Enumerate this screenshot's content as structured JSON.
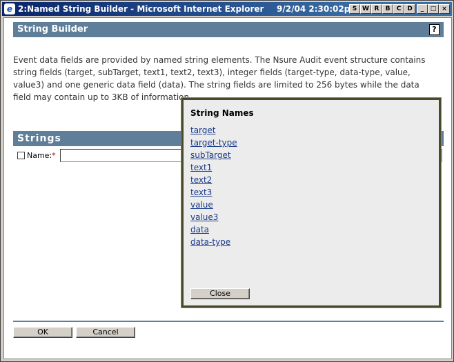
{
  "window": {
    "title": "2:Named String Builder - Microsoft Internet Explorer",
    "clock": "9/2/04 2:30:02pm",
    "buttons": [
      "S",
      "W",
      "R",
      "B",
      "C",
      "D",
      "_",
      "□",
      "×"
    ]
  },
  "header": {
    "title": "String Builder",
    "help": "?"
  },
  "description": "Event data fields are provided by named string elements.  The Nsure Audit event structure contains string fields (target, subTarget, text1, text2, text3), integer fields (target-type, data-type, value, value3) and one generic data field (data).  The string fields are limited to 256 bytes while the data field may contain up to 3KB of information.",
  "strings": {
    "title": "Strings",
    "name_label": "Name:",
    "required_mark": "*",
    "name_value": ""
  },
  "popup": {
    "title": "String Names",
    "items": [
      "target",
      "target-type",
      "subTarget",
      "text1",
      "text2",
      "text3",
      "value",
      "value3",
      "data",
      "data-type"
    ],
    "close_label": "Close"
  },
  "footer": {
    "ok_label": "OK",
    "cancel_label": "Cancel"
  }
}
